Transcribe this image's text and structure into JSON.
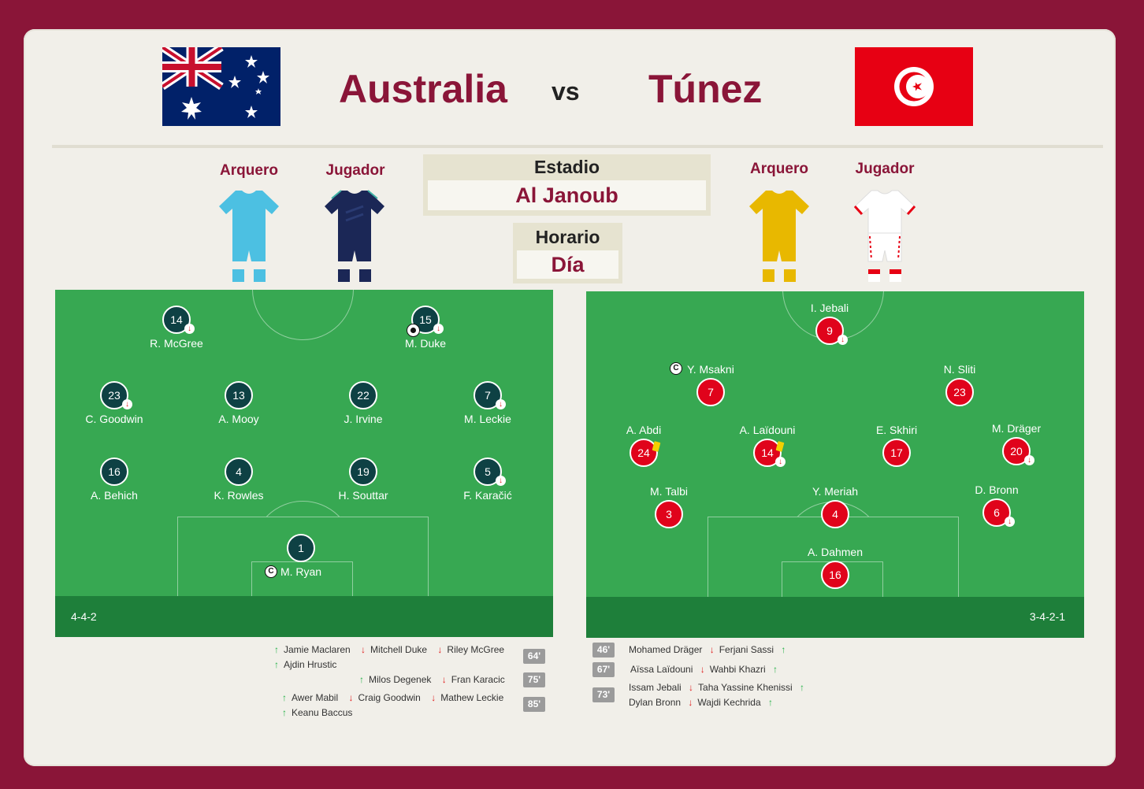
{
  "match": {
    "home": {
      "name": "Australia",
      "formation": "4-4-2"
    },
    "vs": "vs",
    "away": {
      "name": "Túnez",
      "formation": "3-4-2-1"
    }
  },
  "kits": {
    "goalkeeper_label": "Arquero",
    "player_label": "Jugador"
  },
  "info": {
    "stadium_label": "Estadio",
    "stadium": "Al Janoub",
    "time_label": "Horario",
    "time": "Día"
  },
  "colors": {
    "brand": "#8a1538",
    "home_disc": "#0e4144",
    "away_disc": "#e0031b",
    "pitch": "#37a852"
  },
  "home_players": [
    {
      "num": "14",
      "name": "R. McGree"
    },
    {
      "num": "15",
      "name": "M. Duke"
    },
    {
      "num": "23",
      "name": "C. Goodwin"
    },
    {
      "num": "13",
      "name": "A. Mooy"
    },
    {
      "num": "22",
      "name": "J. Irvine"
    },
    {
      "num": "7",
      "name": "M. Leckie"
    },
    {
      "num": "16",
      "name": "A. Behich"
    },
    {
      "num": "4",
      "name": "K. Rowles"
    },
    {
      "num": "19",
      "name": "H. Souttar"
    },
    {
      "num": "5",
      "name": "F. Karačić"
    },
    {
      "num": "1",
      "name": "M. Ryan"
    }
  ],
  "away_players": [
    {
      "num": "9",
      "name": "I. Jebali"
    },
    {
      "num": "7",
      "name": "Y. Msakni"
    },
    {
      "num": "23",
      "name": "N. Sliti"
    },
    {
      "num": "24",
      "name": "A. Abdi"
    },
    {
      "num": "14",
      "name": "A. Laïdouni"
    },
    {
      "num": "17",
      "name": "E. Skhiri"
    },
    {
      "num": "20",
      "name": "M. Dräger"
    },
    {
      "num": "3",
      "name": "M. Talbi"
    },
    {
      "num": "4",
      "name": "Y. Meriah"
    },
    {
      "num": "6",
      "name": "D. Bronn"
    },
    {
      "num": "16",
      "name": "A. Dahmen"
    }
  ],
  "home_subs": {
    "s1": {
      "in1": "Jamie Maclaren",
      "out1": "Mitchell Duke",
      "out2": "Riley McGree",
      "in2": "Ajdin Hrustic",
      "minute": "64'"
    },
    "s2": {
      "in1": "Milos Degenek",
      "out1": "Fran Karacic",
      "minute": "75'"
    },
    "s3": {
      "in1": "Awer Mabil",
      "out1": "Craig Goodwin",
      "out2": "Mathew Leckie",
      "in2": "Keanu Baccus",
      "minute": "85'"
    }
  },
  "away_subs": {
    "s1": {
      "out1": "Mohamed Dräger",
      "in1": "Ferjani Sassi",
      "minute": "46'"
    },
    "s2": {
      "out1": "Aïssa Laïdouni",
      "in1": "Wahbi Khazri",
      "minute": "67'"
    },
    "s3": {
      "out1": "Issam Jebali",
      "in1": "Taha Yassine Khenissi",
      "out2": "Dylan Bronn",
      "in2": "Wajdi Kechrida",
      "minute": "73'"
    }
  },
  "icons": {
    "captain": "C",
    "sub_out": "↓",
    "sub_in": "↑"
  }
}
